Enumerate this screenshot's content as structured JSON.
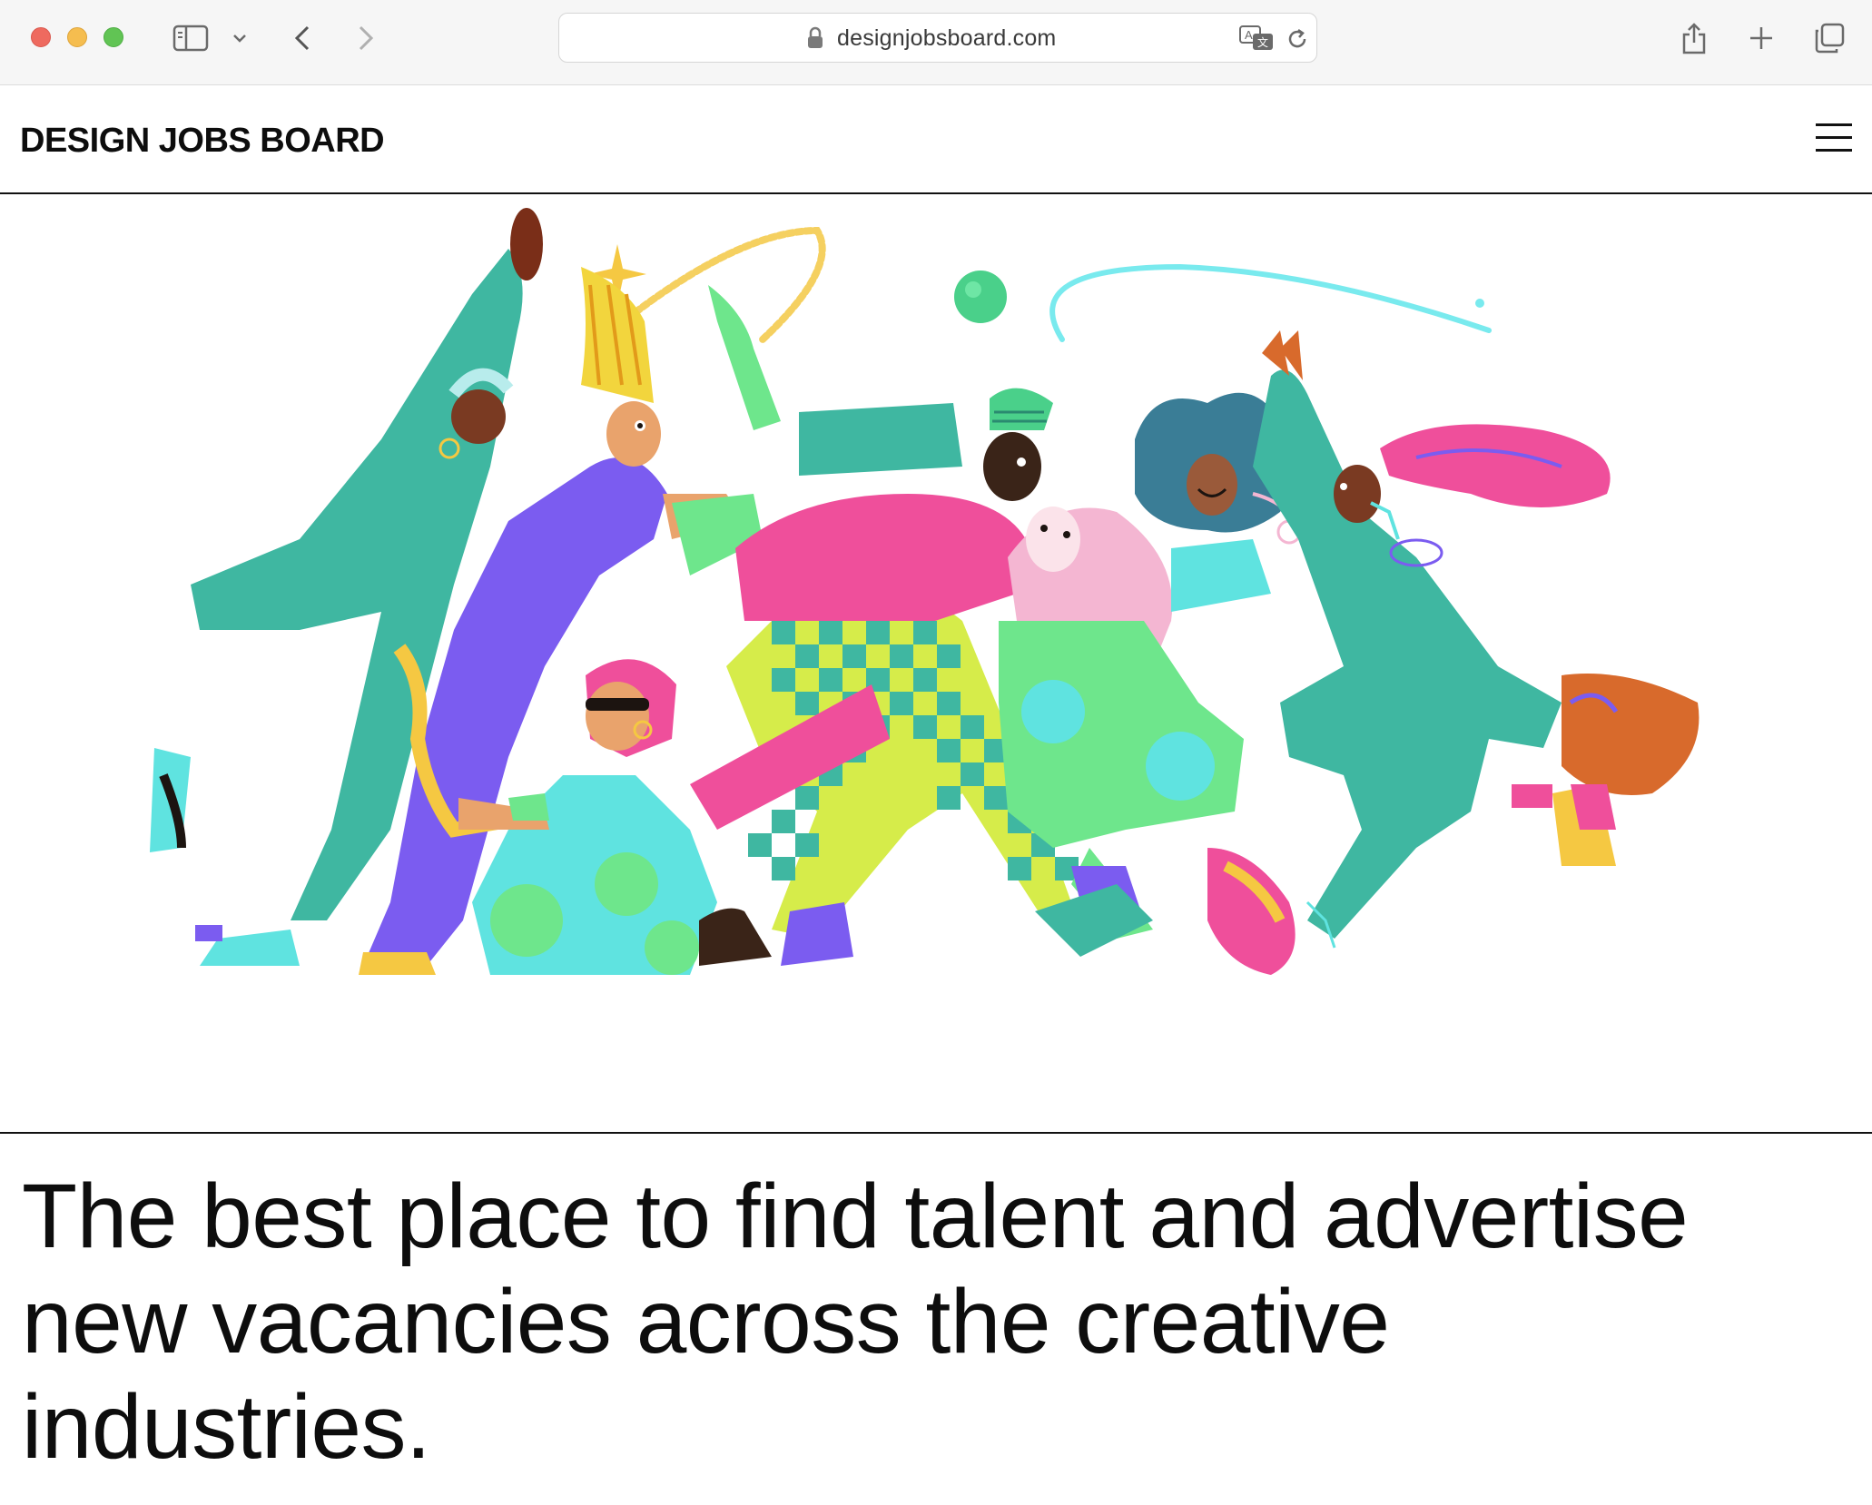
{
  "browser": {
    "url": "designjobsboard.com",
    "icons": [
      "close-window-icon",
      "minimize-window-icon",
      "zoom-window-icon",
      "sidebar-icon",
      "chevron-down-icon",
      "back-icon",
      "forward-icon",
      "lock-icon",
      "translate-icon",
      "reload-icon",
      "share-icon",
      "new-tab-icon",
      "tab-overview-icon"
    ]
  },
  "header": {
    "logo": "DESIGN JOBS BOARD",
    "menu_icon": "hamburger-menu-icon"
  },
  "hero": {
    "illustration": "group of colourful dancing people"
  },
  "main": {
    "headline": "The best place to find talent and advertise new vacancies across the creative industries."
  },
  "colors": {
    "teal": "#3fb7a1",
    "purple": "#7b5cf0",
    "pink": "#ef4f9b",
    "lime": "#d6ec4a",
    "cyan": "#5fe3e0",
    "green": "#6ee68c",
    "yellow": "#f5c842",
    "light_pink": "#f4b6d2",
    "orange": "#d86a2c",
    "dark": "#1c1410"
  }
}
